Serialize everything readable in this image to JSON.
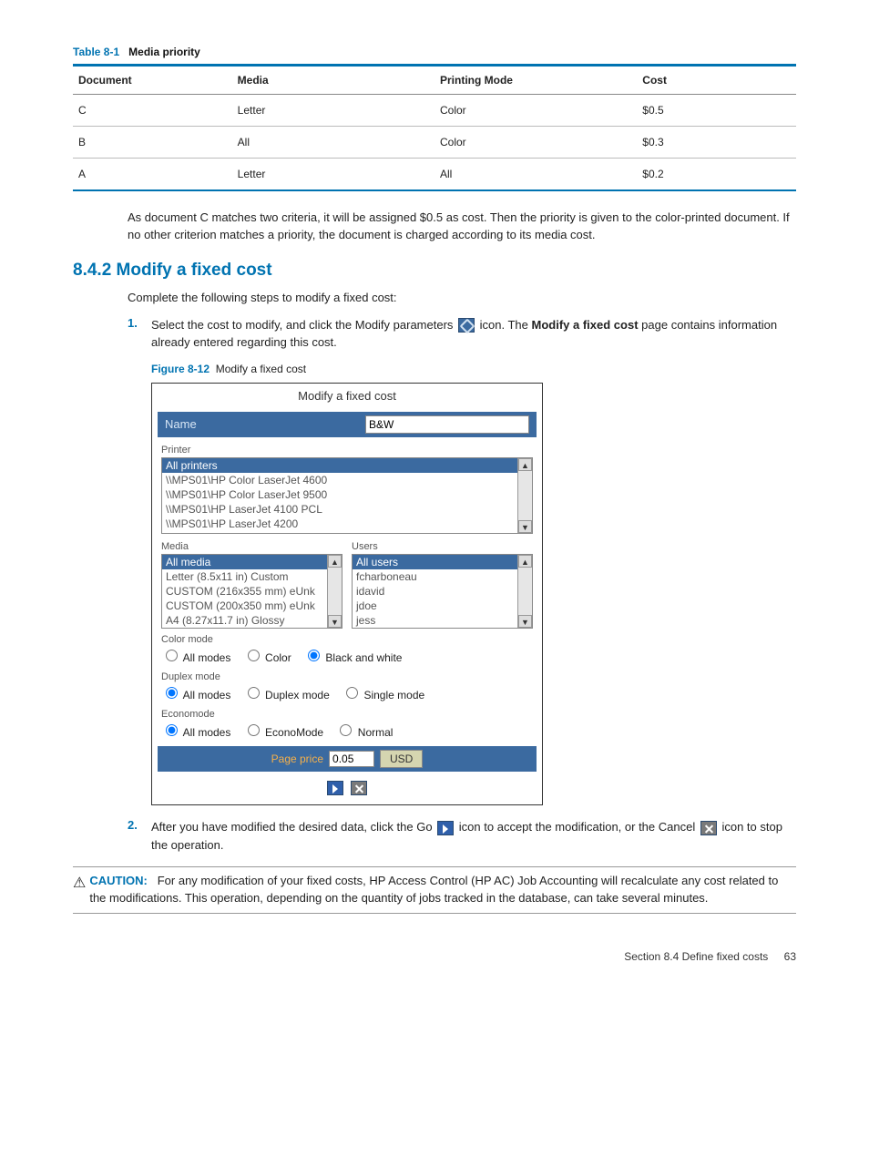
{
  "table": {
    "caption_prefix": "Table 8-1",
    "caption_title": "Media priority",
    "headers": [
      "Document",
      "Media",
      "Printing Mode",
      "Cost"
    ],
    "rows": [
      [
        "C",
        "Letter",
        "Color",
        "$0.5"
      ],
      [
        "B",
        "All",
        "Color",
        "$0.3"
      ],
      [
        "A",
        "Letter",
        "All",
        "$0.2"
      ]
    ]
  },
  "para_after_table": "As document C matches two criteria, it will be assigned $0.5 as cost. Then the priority is given to the color-printed document. If no other criterion matches a priority, the document is charged according to its media cost.",
  "section_heading": "8.4.2 Modify a fixed cost",
  "intro": "Complete the following steps to modify a fixed cost:",
  "step1": {
    "num": "1.",
    "pre": "Select the cost to modify, and click the Modify parameters ",
    "mid1": " icon. The ",
    "bold": "Modify a fixed cost",
    "post": " page contains information already entered regarding this cost."
  },
  "figure": {
    "label": "Figure 8-12",
    "title": "Modify a fixed cost"
  },
  "dialog": {
    "title": "Modify a fixed cost",
    "name_label": "Name",
    "name_value": "B&W",
    "printer_label": "Printer",
    "printers": [
      "All printers",
      "\\\\MPS01\\HP Color LaserJet 4600",
      "\\\\MPS01\\HP Color LaserJet 9500",
      "\\\\MPS01\\HP LaserJet 4100 PCL",
      "\\\\MPS01\\HP LaserJet 4200"
    ],
    "media_label": "Media",
    "media": [
      "All media",
      "Letter (8.5x11 in) Custom",
      "CUSTOM (216x355 mm) eUnk",
      "CUSTOM (200x350 mm) eUnk",
      "A4 (8.27x11.7 in) Glossy"
    ],
    "users_label": "Users",
    "users": [
      "All users",
      "fcharboneau",
      "idavid",
      "jdoe",
      "jess"
    ],
    "color_label": "Color mode",
    "color_opts": [
      "All modes",
      "Color",
      "Black and white"
    ],
    "duplex_label": "Duplex mode",
    "duplex_opts": [
      "All modes",
      "Duplex mode",
      "Single mode"
    ],
    "econo_label": "Economode",
    "econo_opts": [
      "All modes",
      "EconoMode",
      "Normal"
    ],
    "price_label": "Page price",
    "price_value": "0.05",
    "currency": "USD"
  },
  "step2": {
    "num": "2.",
    "pre": "After you have modified the desired data, click the Go ",
    "mid": " icon to accept the modification, or the Cancel ",
    "post": " icon to stop the operation."
  },
  "caution": {
    "label": "CAUTION:",
    "text": "For any modification of your fixed costs, HP Access Control (HP AC) Job Accounting will recalculate any cost related to the modifications. This operation, depending on the quantity of jobs tracked in the database, can take several minutes."
  },
  "footer": {
    "section": "Section 8.4   Define fixed costs",
    "page": "63"
  }
}
